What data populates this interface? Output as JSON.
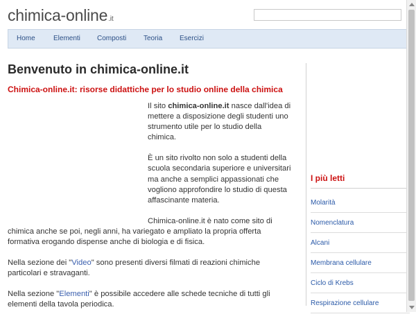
{
  "header": {
    "logo_main": "chimica-online",
    "logo_tld": ".it",
    "search_placeholder": ""
  },
  "nav": {
    "items": [
      "Home",
      "Elementi",
      "Composti",
      "Teoria",
      "Esercizi"
    ]
  },
  "main": {
    "title": "Benvenuto in chimica-online.it",
    "subtitle": "Chimica-online.it: risorse didattiche per lo studio online della chimica",
    "p1_pre": "Il sito ",
    "p1_bold": "chimica-online.it",
    "p1_post": " nasce dall'idea di mettere a disposizione degli studenti uno strumento utile per lo studio della chimica.",
    "p2": "È un sito rivolto non solo a studenti della scuola secondaria superiore e universitari ma anche a semplici appassionati che vogliono approfondire lo studio di questa affascinante materia.",
    "p3": "Chimica-online.it è nato come sito di chimica anche se poi, negli anni, ha variegato e ampliato la propria offerta formativa erogando dispense anche di biologia e di fisica.",
    "p4_pre": "Nella sezione dei \"",
    "p4_link": "Video",
    "p4_post": "\" sono presenti diversi filmati di reazioni chimiche particolari e stravaganti.",
    "p5_pre": "Nella sezione \"",
    "p5_link": "Elementi",
    "p5_post": "\" è possibile accedere alle schede tecniche di tutti gli elementi della tavola periodica."
  },
  "sidebar": {
    "title": "I più letti",
    "items": [
      "Molarità",
      "Nomenclatura",
      "Alcani",
      "Membrana cellulare",
      "Ciclo di Krebs",
      "Respirazione cellulare"
    ]
  },
  "colors": {
    "accent_red": "#cc1111",
    "link_blue": "#2b5aa8",
    "nav_bg": "#dfe9f5"
  }
}
